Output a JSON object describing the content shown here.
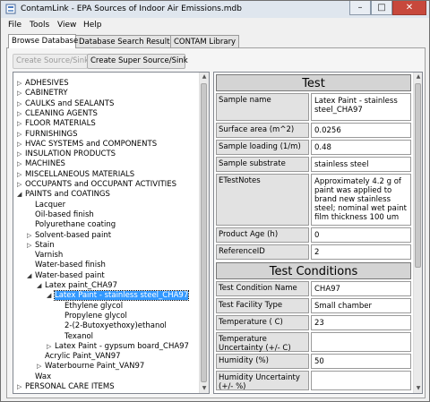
{
  "window": {
    "title": "ContamLink - EPA Sources of Indoor Air Emissions.mdb",
    "minimize_glyph": "–",
    "maximize_glyph": "□",
    "close_glyph": "✕"
  },
  "menu": [
    "File",
    "Tools",
    "View",
    "Help"
  ],
  "tabs": [
    "Browse Database",
    "Database Search Results",
    "CONTAM Library"
  ],
  "buttons": {
    "create_source": "Create Source/Sink",
    "create_super": "Create Super Source/Sink"
  },
  "tree": [
    {
      "label": "ADHESIVES",
      "toggle": "▷"
    },
    {
      "label": "CABINETRY",
      "toggle": "▷"
    },
    {
      "label": "CAULKS and SEALANTS",
      "toggle": "▷"
    },
    {
      "label": "CLEANING AGENTS",
      "toggle": "▷"
    },
    {
      "label": "FLOOR MATERIALS",
      "toggle": "▷"
    },
    {
      "label": "FURNISHINGS",
      "toggle": "▷"
    },
    {
      "label": "HVAC SYSTEMS and COMPONENTS",
      "toggle": "▷"
    },
    {
      "label": "INSULATION PRODUCTS",
      "toggle": "▷"
    },
    {
      "label": "MACHINES",
      "toggle": "▷"
    },
    {
      "label": "MISCELLANEOUS MATERIALS",
      "toggle": "▷"
    },
    {
      "label": "OCCUPANTS and OCCUPANT ACTIVITIES",
      "toggle": "▷"
    },
    {
      "label": "PAINTS and COATINGS",
      "toggle": "◢"
    },
    {
      "label": "Lacquer",
      "toggle": ""
    },
    {
      "label": "Oil-based finish",
      "toggle": ""
    },
    {
      "label": "Polyurethane coating",
      "toggle": ""
    },
    {
      "label": "Solvent-based paint",
      "toggle": "▷"
    },
    {
      "label": "Stain",
      "toggle": "▷"
    },
    {
      "label": "Varnish",
      "toggle": ""
    },
    {
      "label": "Water-based finish",
      "toggle": ""
    },
    {
      "label": "Water-based paint",
      "toggle": "◢"
    },
    {
      "label": "Latex paint_CHA97",
      "toggle": "◢"
    },
    {
      "label": "Latex Paint - stainless steel_CHA97",
      "toggle": "◢"
    },
    {
      "label": "Ethylene glycol",
      "toggle": ""
    },
    {
      "label": "Propylene glycol",
      "toggle": ""
    },
    {
      "label": "2-(2-Butoxyethoxy)ethanol",
      "toggle": ""
    },
    {
      "label": "Texanol",
      "toggle": ""
    },
    {
      "label": "Latex Paint - gypsum board_CHA97",
      "toggle": "▷"
    },
    {
      "label": "Acrylic Paint_VAN97",
      "toggle": ""
    },
    {
      "label": "Waterbourne Paint_VAN97",
      "toggle": "▷"
    },
    {
      "label": "Wax",
      "toggle": ""
    },
    {
      "label": "PERSONAL CARE ITEMS",
      "toggle": "▷"
    }
  ],
  "detail": {
    "test_header": "Test",
    "test_rows": [
      {
        "label": "Sample name",
        "value": "Latex Paint - stainless steel_CHA97"
      },
      {
        "label": "Surface area (m^2)",
        "value": "0.0256"
      },
      {
        "label": "Sample loading (1/m)",
        "value": "0.48"
      },
      {
        "label": "Sample substrate",
        "value": "stainless steel"
      },
      {
        "label": "ETestNotes",
        "value": "Approximately 4.2 g of paint was applied to brand new stainless steel; nominal wet paint film thickness 100 um"
      },
      {
        "label": "Product Age (h)",
        "value": "0"
      },
      {
        "label": "ReferenceID",
        "value": "2"
      }
    ],
    "conditions_header": "Test Conditions",
    "conditions_rows": [
      {
        "label": "Test Condition Name",
        "value": "CHA97"
      },
      {
        "label": "Test Facility Type",
        "value": "Small chamber"
      },
      {
        "label": "Temperature ( C)",
        "value": "23"
      },
      {
        "label": "Temperature Uncertainty (+/- C)",
        "value": ""
      },
      {
        "label": "Humidity (%)",
        "value": "50"
      },
      {
        "label": "Humidity Uncertainty (+/- %)",
        "value": ""
      }
    ]
  }
}
